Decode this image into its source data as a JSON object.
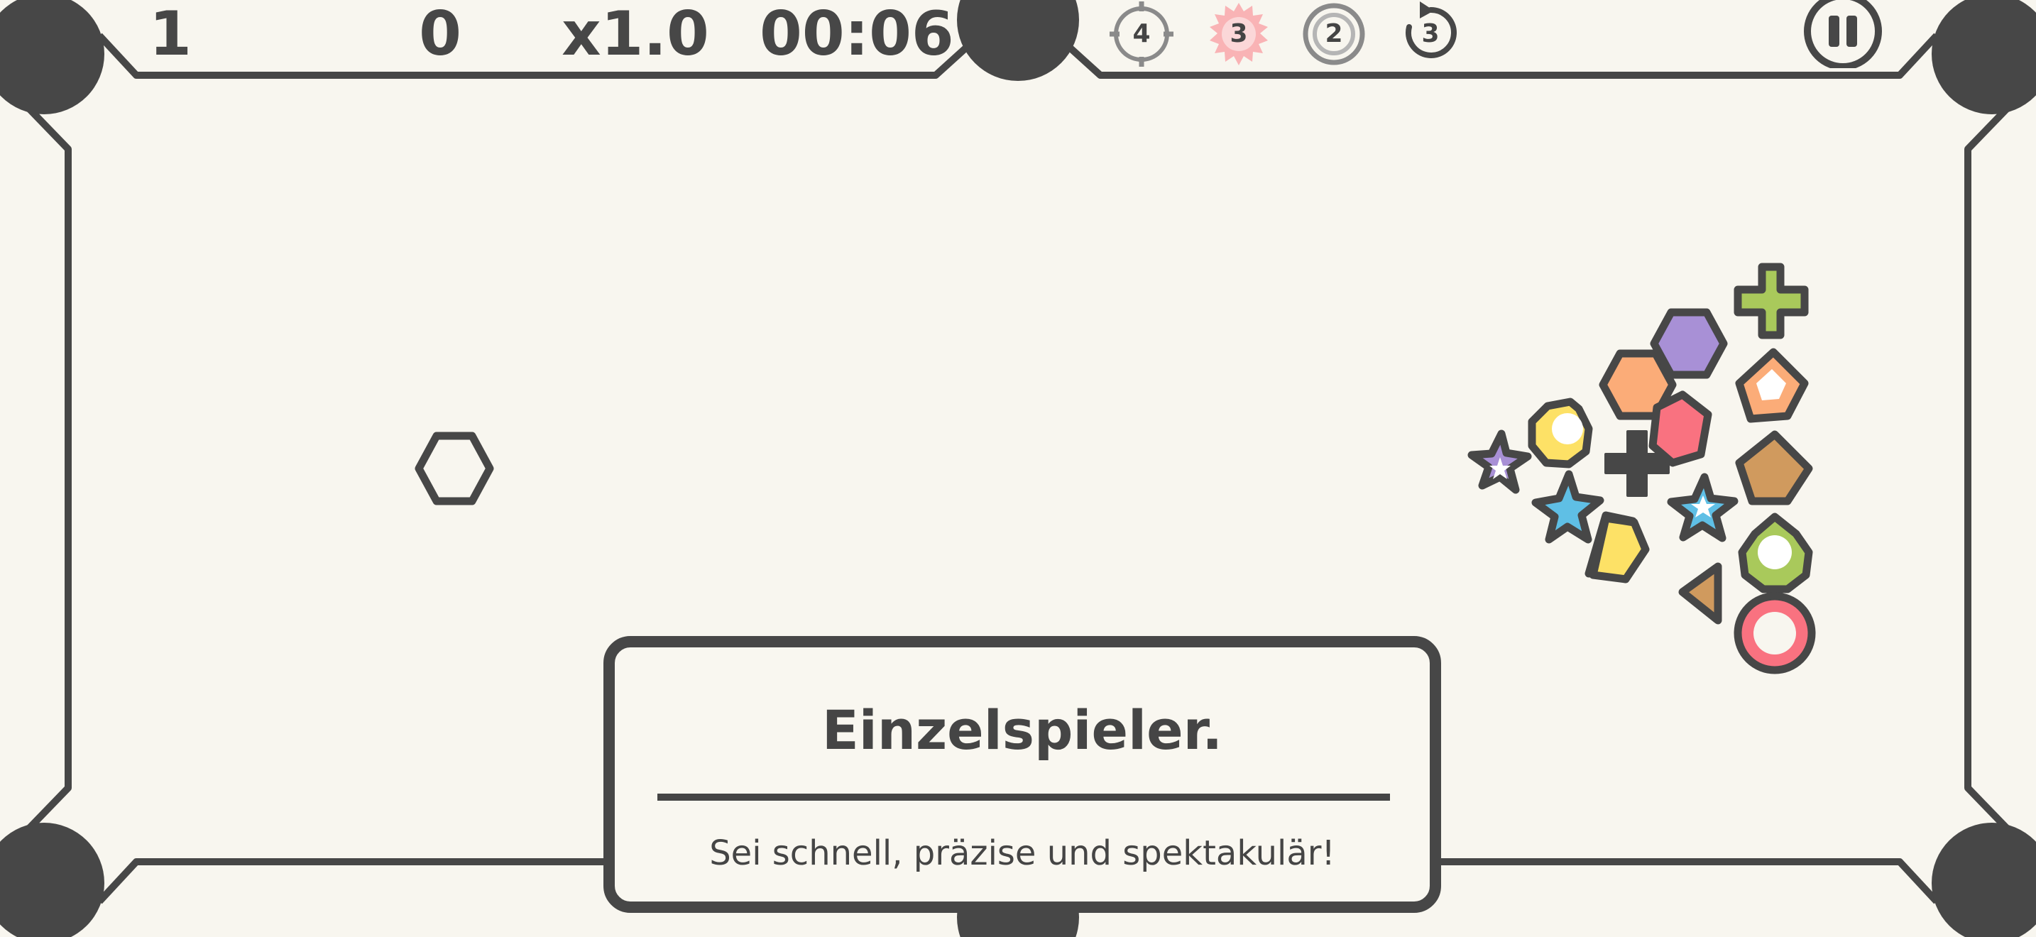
{
  "hud": {
    "level": "1",
    "score": "0",
    "multiplier": "x1.0",
    "timer": "00:06"
  },
  "powerups": {
    "target_count": "4",
    "burst_count": "3",
    "ring_count": "2",
    "undo_count": "3"
  },
  "panel": {
    "title": "Einzelspieler.",
    "subtitle": "Sei schnell, präzise und spektakulär!"
  },
  "icons": {
    "pause": "pause-icon",
    "target": "crosshair-icon",
    "burst": "starburst-icon",
    "ring": "ring-icon",
    "undo": "undo-icon"
  },
  "colors": {
    "background": "#f8f6ef",
    "ink": "#474747",
    "yellow": "#fde166",
    "orange": "#fbac78",
    "purple": "#a890d6",
    "green": "#a9c95b",
    "red": "#f97280",
    "blue": "#5fbfe5",
    "brown": "#d09a5e",
    "burst_pink": "#f9b3b5"
  }
}
